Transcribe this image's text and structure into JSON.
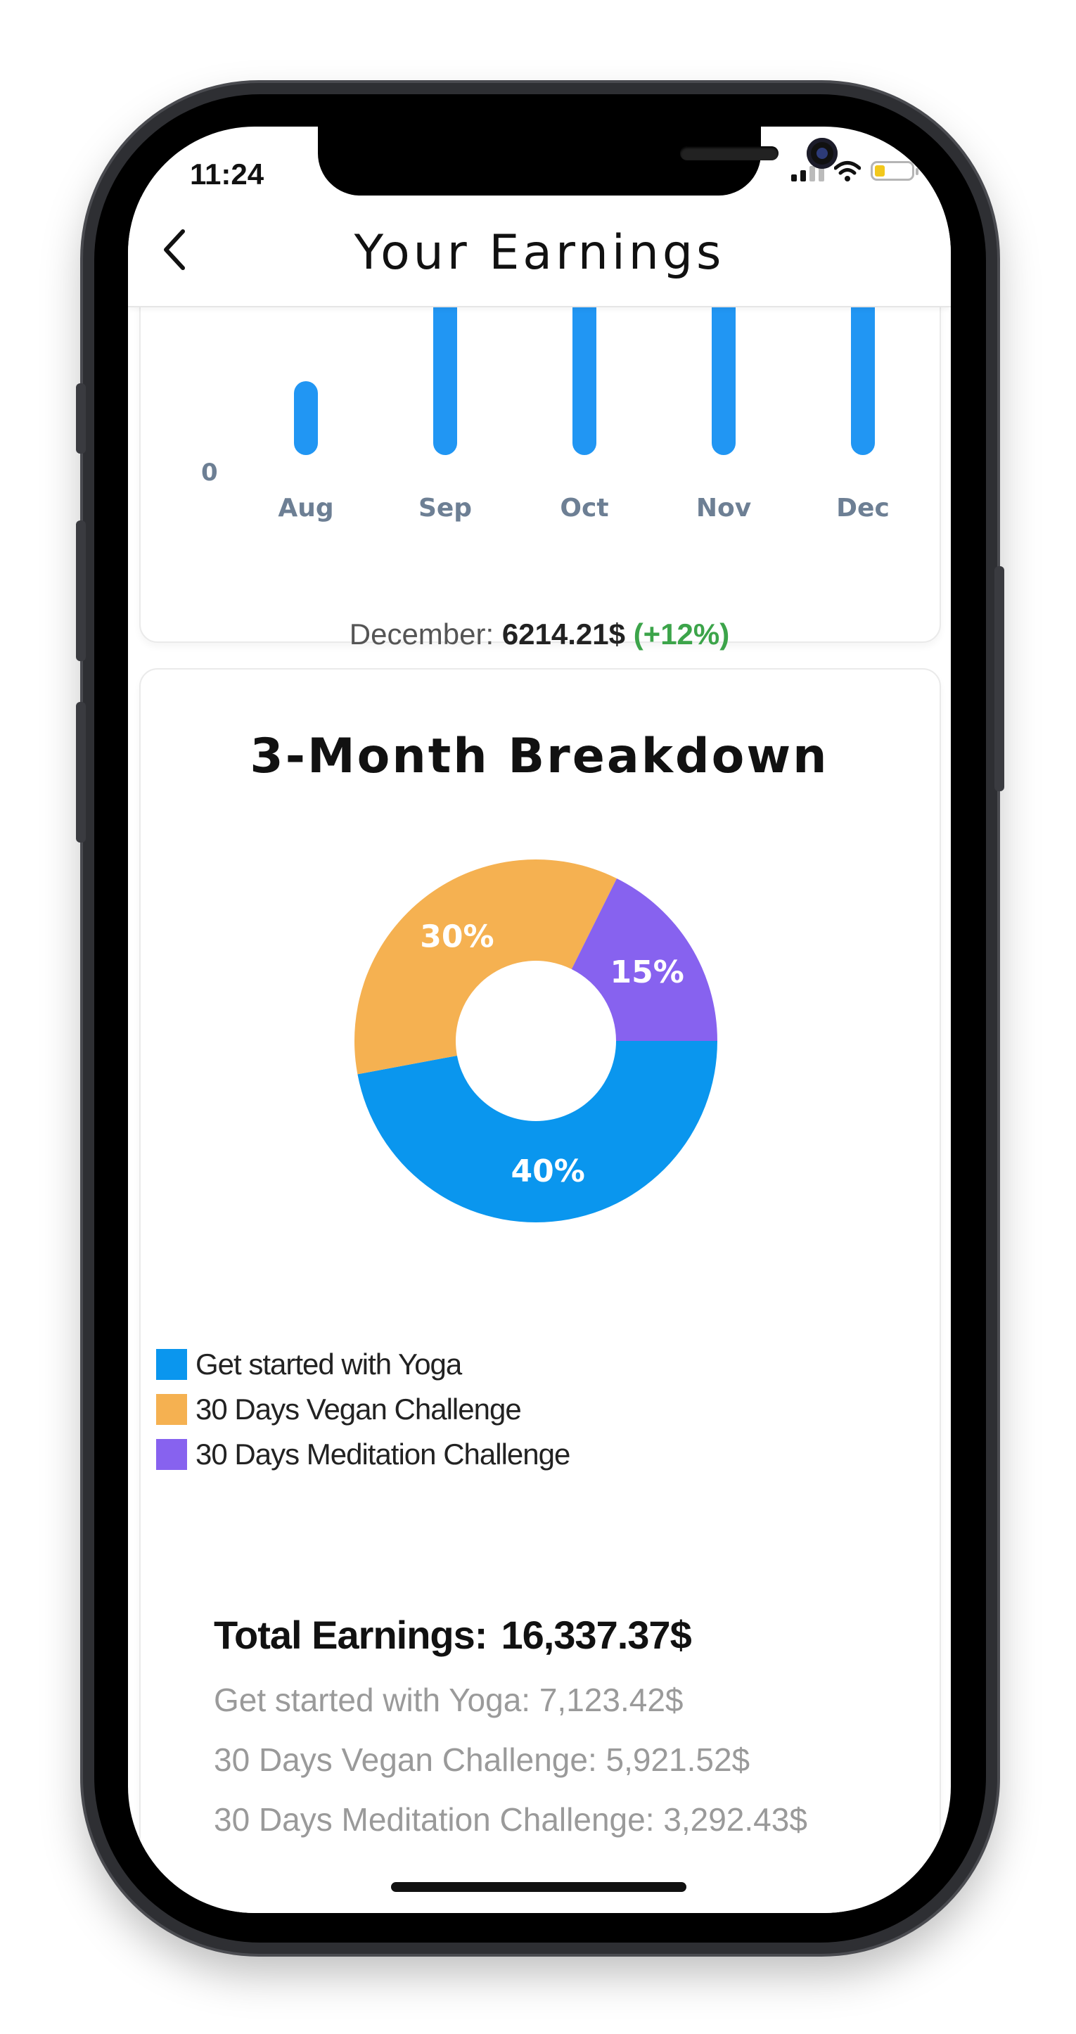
{
  "status": {
    "time": "11:24"
  },
  "header": {
    "title": "Your Earnings"
  },
  "monthly_chart": {
    "zero_label": "0",
    "months": [
      "Aug",
      "Sep",
      "Oct",
      "Nov",
      "Dec"
    ],
    "bar_color": "#2196f3"
  },
  "summary": {
    "label": "December:",
    "amount": "6214.21$",
    "change": "(+12%)"
  },
  "breakdown": {
    "title": "3-Month Breakdown",
    "legend": [
      {
        "label": "Get started with Yoga",
        "color": "#0a96ee"
      },
      {
        "label": "30 Days Vegan Challenge",
        "color": "#f5b151"
      },
      {
        "label": "30 Days Meditation Challenge",
        "color": "#8762ef"
      }
    ]
  },
  "chart_data": {
    "type": "pie",
    "categories": [
      "Get started with Yoga",
      "30 Days Vegan Challenge",
      "30 Days Meditation Challenge"
    ],
    "values": [
      40,
      30,
      15
    ],
    "labels": [
      "40%",
      "30%",
      "15%"
    ],
    "colors": [
      "#0a96ee",
      "#f5b151",
      "#8762ef"
    ]
  },
  "totals": {
    "total_label": "Total Earnings:",
    "total_value": "16,337.37$",
    "items": [
      "Get started with Yoga: 7,123.42$",
      "30 Days Vegan Challenge: 5,921.52$",
      "30 Days Meditation Challenge: 3,292.43$"
    ]
  }
}
